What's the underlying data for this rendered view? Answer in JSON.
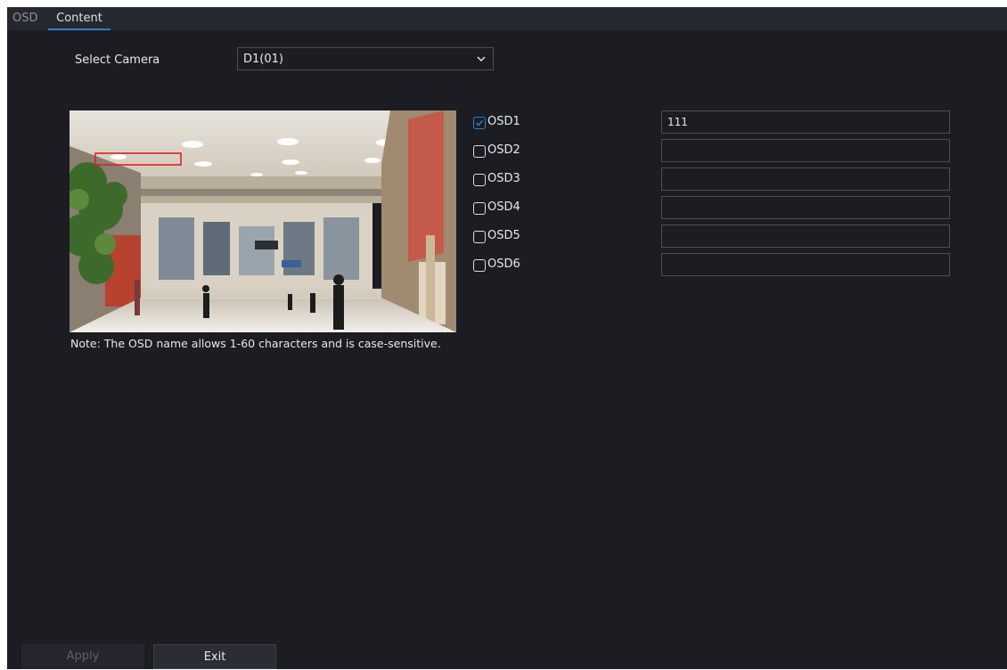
{
  "tabs": {
    "osd_label": "OSD",
    "content_label": "Content"
  },
  "camera": {
    "label": "Select Camera",
    "selected": "D1(01)"
  },
  "preview": {
    "description_icon": "camera-preview-image"
  },
  "osd_items": [
    {
      "label": "OSD1",
      "checked": true,
      "value": "111"
    },
    {
      "label": "OSD2",
      "checked": false,
      "value": ""
    },
    {
      "label": "OSD3",
      "checked": false,
      "value": ""
    },
    {
      "label": "OSD4",
      "checked": false,
      "value": ""
    },
    {
      "label": "OSD5",
      "checked": false,
      "value": ""
    },
    {
      "label": "OSD6",
      "checked": false,
      "value": ""
    }
  ],
  "note": "Note: The OSD name allows 1-60 characters and is case-sensitive.",
  "buttons": {
    "apply": "Apply",
    "exit": "Exit"
  },
  "colors": {
    "accent": "#2f7fd0",
    "background": "#1b1d22",
    "osd_box": "#e02020"
  }
}
